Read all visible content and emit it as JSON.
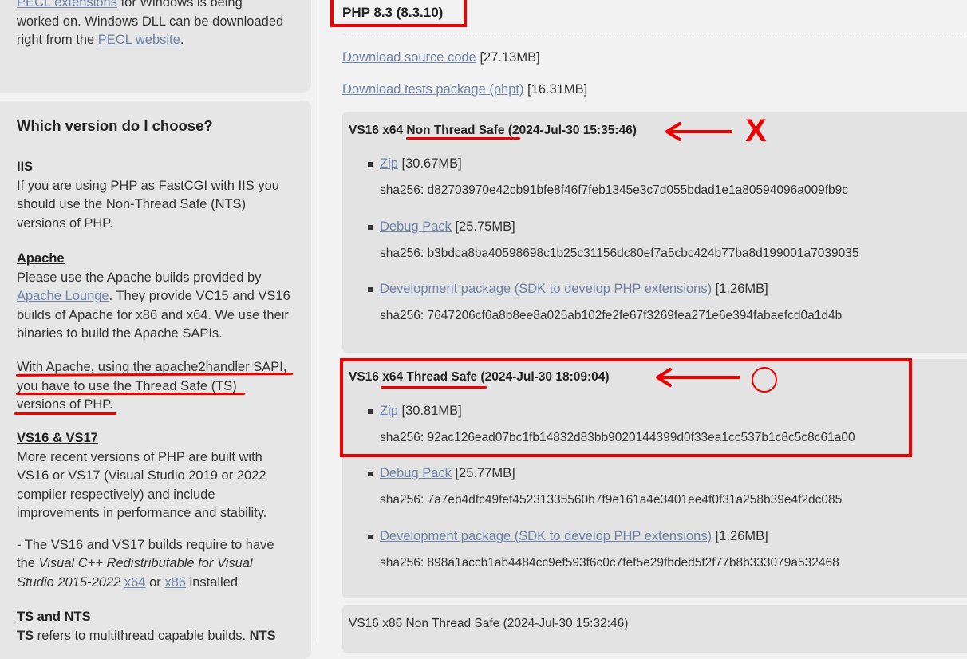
{
  "sidebar": {
    "pecl": {
      "lines": [
        {
          "link": "PECL extensions",
          "text": " for Windows is being"
        },
        {
          "text": "worked on. Windows DLL can be downloaded"
        },
        {
          "prefix": "right from the ",
          "link": "PECL website",
          "suffix": "."
        }
      ]
    },
    "choose": {
      "heading": "Which version do I choose?",
      "iis": {
        "title": "IIS",
        "body": "If you are using PHP as FastCGI with IIS you should use the Non-Thread Safe (NTS) versions of PHP."
      },
      "apache": {
        "title": "Apache",
        "p1_prefix": "Please use the Apache builds provided by ",
        "p1_link": "Apache Lounge",
        "p1_suffix": ". They provide VC15 and VS16 builds of Apache for x86 and x64. We use their binaries to build the Apache SAPIs.",
        "p2_line1": "With Apache, using the apache2handler SAPI,",
        "p2_line2": "you have to use the Thread Safe (TS)",
        "p2_line3": "versions of PHP."
      },
      "vs": {
        "title": "VS16 & VS17",
        "body": "More recent versions of PHP are built with VS16 or VS17 (Visual Studio 2019 or 2022 compiler respectively) and include improvements in performance and stability.",
        "p2_prefix": "- The VS16 and VS17 builds require to have the ",
        "p2_italic": "Visual C++ Redistributable for Visual Studio 2015-2022",
        "p2_space": " ",
        "p2_link1": "x64",
        "p2_or": " or ",
        "p2_link2": "x86",
        "p2_suffix": " installed"
      },
      "tsnts": {
        "title": "TS and NTS",
        "line_bold1": "TS",
        "line_mid": " refers to multithread capable builds. ",
        "line_bold2": "NTS"
      }
    }
  },
  "main": {
    "version_title": "PHP 8.3 (8.3.10)",
    "source": {
      "link": "Download source code",
      "size": " [27.13MB]"
    },
    "tests": {
      "link": "Download tests package (phpt)",
      "size": " [16.31MB]"
    },
    "builds": [
      {
        "title": "VS16 x64 Non Thread Safe (2024-Jul-30 15:35:46)",
        "zip": {
          "link": "Zip",
          "size": " [30.67MB]",
          "sha": "sha256: d82703970e42cb91bfe8f46f7feb1345e3c7d055bdad1e1a80594096a009fb9c"
        },
        "debug": {
          "link": "Debug Pack",
          "size": " [25.75MB]",
          "sha": "sha256: b3bdca8ba40598698c1b25c31156dc80ef7a5cbc424b77ba8d199001a7039035"
        },
        "devel": {
          "link": "Development package (SDK to develop PHP extensions)",
          "size": " [1.26MB]",
          "sha": "sha256: 7647206cf6a8b8ee8a025ab102fe2fe67f3269fea271e6e394fabaefcd0a1d4b"
        }
      },
      {
        "title": "VS16 x64 Thread Safe (2024-Jul-30 18:09:04)",
        "zip": {
          "link": "Zip",
          "size": " [30.81MB]",
          "sha": "sha256: 92ac126ead07bc1fb14832d83bb9020144399d0f33ea1cc537b1c8c5c8c61a00"
        },
        "debug": {
          "link": "Debug Pack",
          "size": " [25.77MB]",
          "sha": "sha256: 7a7eb4dfc49fef45231335560b7f9e161a4e3401ee4f0f31a258b39e4f2dc085"
        },
        "devel": {
          "link": "Development package (SDK to develop PHP extensions)",
          "size": " [1.26MB]",
          "sha": "sha256: 898a1accb1ab4484cc9ef593f6c0c7fef5e29fbded5f2f77b8b333079a532468"
        }
      },
      {
        "title": "VS16 x86 Non Thread Safe (2024-Jul-30 15:32:46)"
      }
    ]
  },
  "annotations": {
    "nts_mark": "X",
    "accent_color": "#e00000"
  }
}
